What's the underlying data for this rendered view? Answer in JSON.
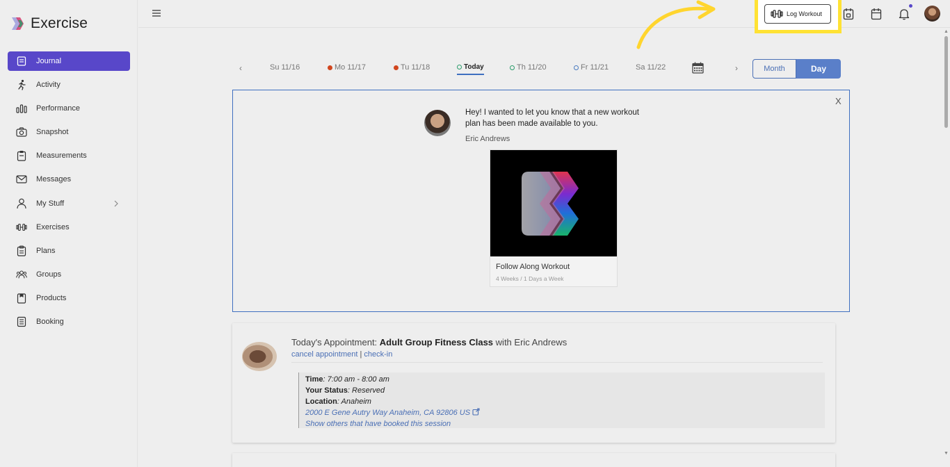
{
  "app": {
    "name": "Exercise",
    "brand_color": "#5847c9",
    "highlight_color": "#ffe234"
  },
  "sidebar": {
    "items": [
      {
        "label": "Journal",
        "icon": "journal-icon",
        "active": true
      },
      {
        "label": "Activity",
        "icon": "running-person-icon"
      },
      {
        "label": "Performance",
        "icon": "bar-chart-icon"
      },
      {
        "label": "Snapshot",
        "icon": "camera-icon"
      },
      {
        "label": "Measurements",
        "icon": "clipboard-icon"
      },
      {
        "label": "Messages",
        "icon": "envelope-icon"
      },
      {
        "label": "My Stuff",
        "icon": "person-icon",
        "has_submenu": true
      },
      {
        "label": "Exercises",
        "icon": "dumbbell-icon"
      },
      {
        "label": "Plans",
        "icon": "clipboard-list-icon"
      },
      {
        "label": "Groups",
        "icon": "group-icon"
      },
      {
        "label": "Products",
        "icon": "product-box-icon"
      },
      {
        "label": "Booking",
        "icon": "booking-list-icon"
      }
    ]
  },
  "topbar": {
    "log_workout_label": "Log Workout",
    "icons": [
      "calendar-check-icon",
      "calendar-icon",
      "bell-icon",
      "user-avatar"
    ],
    "has_notification": true
  },
  "date_nav": {
    "days": [
      {
        "label": "Su 11/16",
        "marker": "none"
      },
      {
        "label": "Mo 11/17",
        "marker": "filled-red"
      },
      {
        "label": "Tu 11/18",
        "marker": "filled-red"
      },
      {
        "label": "Today",
        "marker": "open-green",
        "current": true
      },
      {
        "label": "Th 11/20",
        "marker": "open-green"
      },
      {
        "label": "Fr 11/21",
        "marker": "open-blue"
      },
      {
        "label": "Sa 11/22",
        "marker": "none"
      }
    ],
    "prev": "‹",
    "next": "›",
    "view_month": "Month",
    "view_day": "Day",
    "selected_view": "Day"
  },
  "message": {
    "close": "X",
    "text": "Hey! I wanted to let you know that a new workout plan has been made available to you.",
    "author": "Eric Andrews",
    "plan": {
      "title": "Follow Along Workout",
      "subtitle": "4 Weeks / 1 Days a Week"
    }
  },
  "appointment": {
    "prefix": "Today's Appointment:",
    "class_name": "Adult Group Fitness Class",
    "with_text": "with Eric Andrews",
    "cancel_link": "cancel appointment",
    "separator": "|",
    "checkin_link": "check-in",
    "time_label": "Time",
    "time_value": ": 7:00 am - 8:00 am",
    "status_label": "Your Status",
    "status_value": ": Reserved",
    "location_label": "Location",
    "location_value": ": Anaheim",
    "address": "2000 E Gene Autry Way Anaheim, CA 92806 US",
    "others_link": "Show others that have booked this session"
  }
}
